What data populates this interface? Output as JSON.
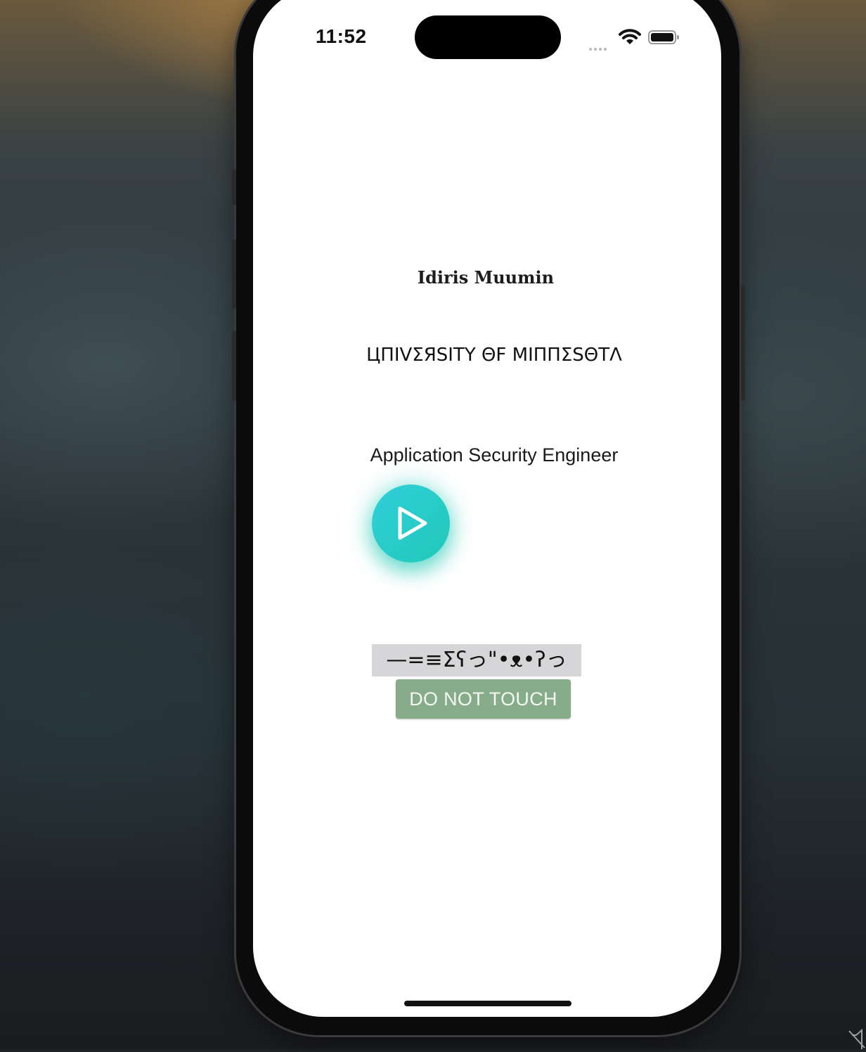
{
  "status_bar": {
    "time": "11:52",
    "wifi_icon": "wifi-icon",
    "battery_icon": "battery-icon",
    "signal_icon": "signal-dots-icon"
  },
  "profile": {
    "name": "Idiris Muumin",
    "university": "ЦПIVΣЯЅITY ΘF MIППΣЅΘTΛ",
    "role": "Application Security Engineer"
  },
  "play_button": {
    "icon": "play-icon",
    "color": "#2bcfc8"
  },
  "kaomoji": "—=≡Σʕっ\"•ᴥ•ʔっ",
  "do_not_touch_button": {
    "label": "DO NOT TOUCH",
    "color": "#87ac8a"
  },
  "desktop": {
    "mute_icon": "speaker-muted-icon"
  }
}
